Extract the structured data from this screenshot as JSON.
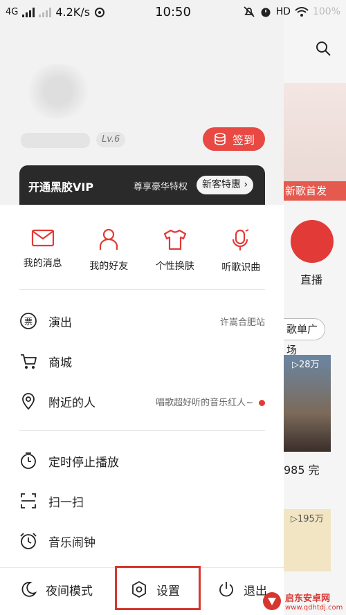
{
  "status_bar": {
    "network": "4G",
    "speed": "4.2K/s",
    "time": "10:50",
    "hd": "HD",
    "battery": "100%"
  },
  "profile": {
    "level": "Lv.6",
    "signin_label": "签到"
  },
  "vip": {
    "title": "开通黑胶VIP",
    "subtitle": "尊享豪华特权",
    "pill": "新客特惠"
  },
  "quick_actions": [
    {
      "label": "我的消息",
      "icon": "mail-icon"
    },
    {
      "label": "我的好友",
      "icon": "person-icon"
    },
    {
      "label": "个性换肤",
      "icon": "shirt-icon"
    },
    {
      "label": "听歌识曲",
      "icon": "mic-icon"
    }
  ],
  "menu": {
    "show": {
      "label": "演出",
      "extra": "许嵩合肥站"
    },
    "mall": {
      "label": "商城"
    },
    "nearby": {
      "label": "附近的人",
      "extra": "唱歌超好听的音乐红人~"
    },
    "timer": {
      "label": "定时停止播放"
    },
    "scan": {
      "label": "扫一扫"
    },
    "alarm": {
      "label": "音乐闹钟"
    }
  },
  "bottom": {
    "night_mode": "夜间模式",
    "settings": "设置",
    "logout": "退出"
  },
  "background_app": {
    "banner_label": "新歌首发",
    "live_label": "直播",
    "square_label": "歌单广场",
    "play_count_1": "▷28万",
    "photo_title": "985 完",
    "play_count_2": "▷195万"
  },
  "watermark": {
    "title": "启东安卓网",
    "url": "www.qdhtdj.com"
  },
  "colors": {
    "accent": "#e84942",
    "highlight_box": "#d6362f",
    "vip_bg": "#2b2a2b"
  }
}
